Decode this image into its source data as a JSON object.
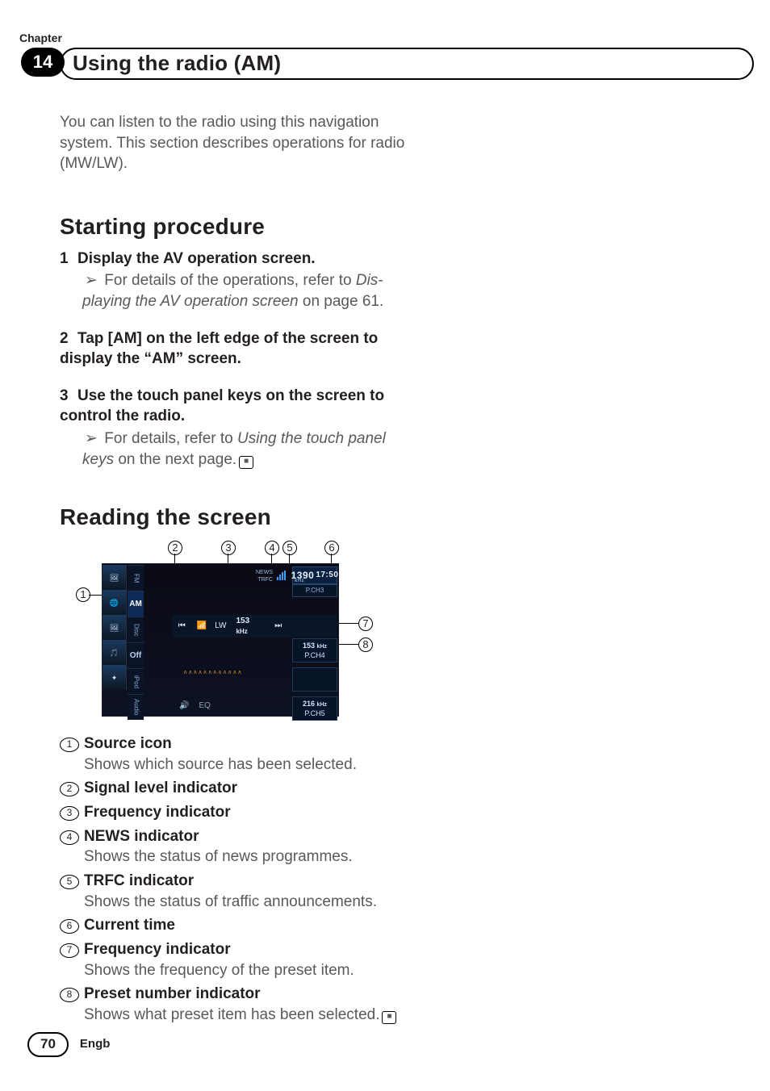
{
  "chapter_label": "Chapter",
  "chapter_number": "14",
  "page_title": "Using the radio (AM)",
  "intro": "You can listen to the radio using this naviga­tion system. This section describes operations for radio (MW/LW).",
  "section1": {
    "heading": "Starting procedure",
    "steps": [
      {
        "num": "1",
        "title": "Display the AV operation screen.",
        "ref_prefix": "For details of the operations, refer to ",
        "ref_italic": "Dis­playing the AV operation screen",
        "ref_suffix": " on page 61."
      },
      {
        "num": "2",
        "title": "Tap [AM] on the left edge of the screen to display the “AM” screen."
      },
      {
        "num": "3",
        "title": "Use the touch panel keys on the screen to control the radio.",
        "ref_prefix": "For details, refer to ",
        "ref_italic": "Using the touch panel keys",
        "ref_suffix": " on the next page."
      }
    ]
  },
  "section2": {
    "heading": "Reading the screen",
    "items": [
      {
        "n": "1",
        "title": "Source icon",
        "desc": "Shows which source has been selected."
      },
      {
        "n": "2",
        "title": "Signal level indicator"
      },
      {
        "n": "3",
        "title": "Frequency indicator"
      },
      {
        "n": "4",
        "title": "NEWS indicator",
        "desc": "Shows the status of news programmes."
      },
      {
        "n": "5",
        "title": "TRFC indicator",
        "desc": "Shows the status of traffic announcements."
      },
      {
        "n": "6",
        "title": "Current time"
      },
      {
        "n": "7",
        "title": "Frequency indicator",
        "desc": "Shows the frequency of the preset item."
      },
      {
        "n": "8",
        "title": "Preset number indicator",
        "desc": "Shows what preset item has been selected."
      }
    ]
  },
  "diagram": {
    "sources": {
      "fm": "FM",
      "am": "AM",
      "disc": "Disc",
      "off": "Off",
      "sd": "SD",
      "ipod": "iPod",
      "audio": "Audio"
    },
    "news": "NEWS",
    "trfc": "TRFC",
    "clock_freq": "1390",
    "clock_time": "17:50",
    "clock_unit": "kHz",
    "pch_top": "P.CH3",
    "tuner": {
      "prev": "⏮",
      "sig": " ",
      "band": "LW",
      "freq": "153",
      "unit": "kHz",
      "next": "⏭"
    },
    "presets": [
      {
        "freq": "153",
        "unit": "kHz",
        "label": "P.CH4"
      },
      {
        "freq": "",
        "unit": "",
        "label": ""
      },
      {
        "freq": "216",
        "unit": "kHz",
        "label": "P.CH5"
      }
    ],
    "bottom": {
      "sound": "🔊",
      "eq": "EQ"
    },
    "bt": "✦",
    "wave": "∧∧∧∧∧∧∧∧∧∧∧∧"
  },
  "footer": {
    "page": "70",
    "locale": "Engb"
  },
  "glyphs": {
    "ref": "➢",
    "end": "■",
    "circled": [
      "①",
      "②",
      "③",
      "④",
      "⑤",
      "⑥",
      "⑦",
      "⑧"
    ]
  }
}
